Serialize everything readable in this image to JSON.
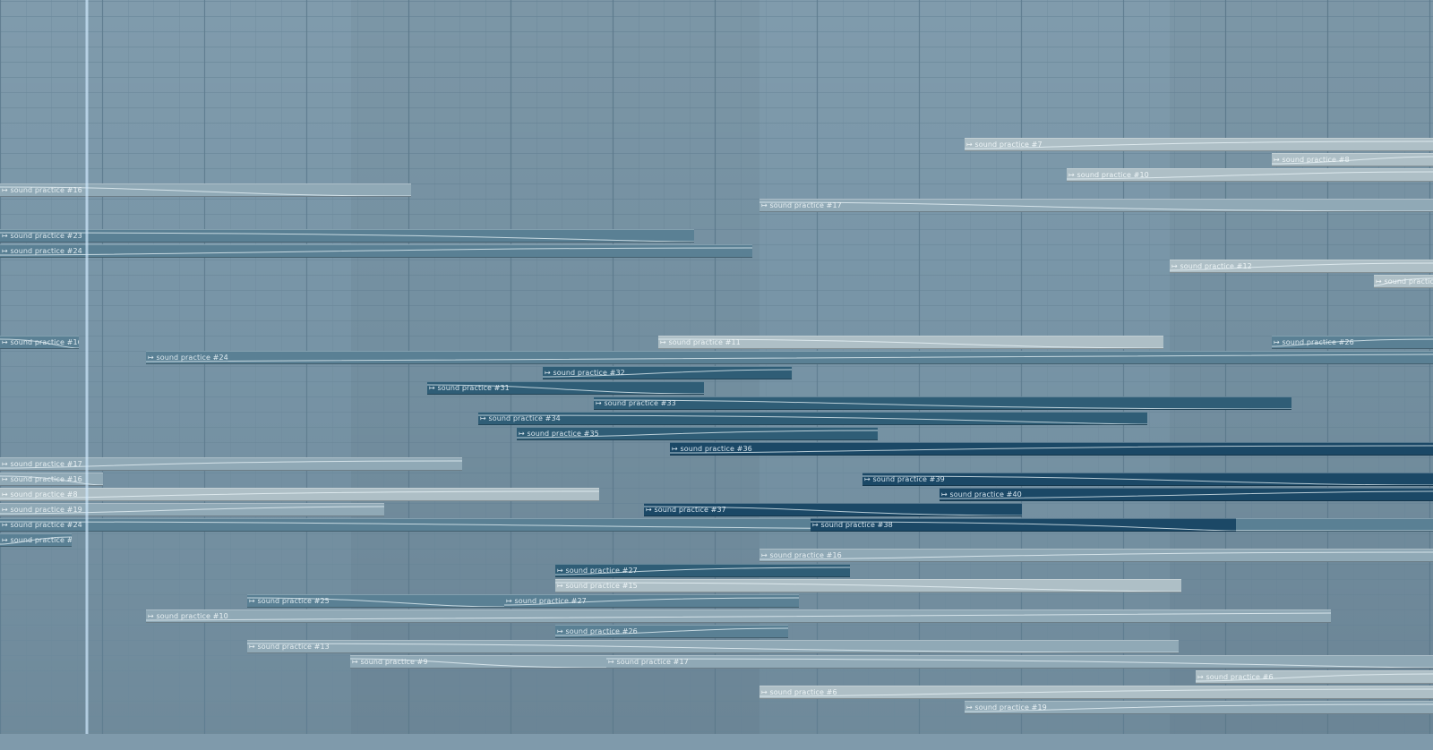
{
  "playlist": {
    "clip_prefix_icon": "audio-clip-icon",
    "clips": [
      {
        "label": "sound practice  #7",
        "row": 9,
        "start": 1077,
        "end": 1600,
        "tone": "pale"
      },
      {
        "label": "sound practice  #8",
        "row": 10,
        "start": 1420,
        "end": 1600,
        "tone": "pale"
      },
      {
        "label": "sound practice  #10",
        "row": 11,
        "start": 1191,
        "end": 1600,
        "tone": "pale"
      },
      {
        "label": "sound practice  #16",
        "row": 12,
        "start": 0,
        "end": 459,
        "tone": "light"
      },
      {
        "label": "sound practice  #17",
        "row": 13,
        "start": 848,
        "end": 1600,
        "tone": "light"
      },
      {
        "label": "sound practice  #23",
        "row": 15,
        "start": 0,
        "end": 775,
        "tone": "mid"
      },
      {
        "label": "sound practice  #24",
        "row": 16,
        "start": 0,
        "end": 840,
        "tone": "mid"
      },
      {
        "label": "sound practice  #12",
        "row": 17,
        "start": 1306,
        "end": 1600,
        "tone": "pale"
      },
      {
        "label": "sound practice  #13",
        "row": 18,
        "start": 1534,
        "end": 1600,
        "tone": "pale"
      },
      {
        "label": "sound practice  #16",
        "row": 22,
        "start": 0,
        "end": 88,
        "tone": "mid"
      },
      {
        "label": "sound practice  #11",
        "row": 22,
        "start": 735,
        "end": 1299,
        "tone": "pale"
      },
      {
        "label": "sound practice  #26",
        "row": 22,
        "start": 1420,
        "end": 1600,
        "tone": "mid"
      },
      {
        "label": "sound practice  #24",
        "row": 23,
        "start": 163,
        "end": 1600,
        "tone": "mid"
      },
      {
        "label": "sound practice  #32",
        "row": 24,
        "start": 606,
        "end": 884,
        "tone": "dark"
      },
      {
        "label": "sound practice  #31",
        "row": 25,
        "start": 477,
        "end": 786,
        "tone": "dark"
      },
      {
        "label": "sound practice  #33",
        "row": 26,
        "start": 663,
        "end": 1442,
        "tone": "dark"
      },
      {
        "label": "sound practice  #34",
        "row": 27,
        "start": 534,
        "end": 1281,
        "tone": "dark"
      },
      {
        "label": "sound practice  #35",
        "row": 28,
        "start": 577,
        "end": 980,
        "tone": "dark"
      },
      {
        "label": "sound practice  #36",
        "row": 29,
        "start": 748,
        "end": 1600,
        "tone": "deep"
      },
      {
        "label": "sound practice  #17",
        "row": 30,
        "start": 0,
        "end": 516,
        "tone": "light"
      },
      {
        "label": "sound practice  #16",
        "row": 31,
        "start": 0,
        "end": 115,
        "tone": "light"
      },
      {
        "label": "sound practice  #39",
        "row": 31,
        "start": 963,
        "end": 1600,
        "tone": "deep"
      },
      {
        "label": "sound practice  #8",
        "row": 32,
        "start": 0,
        "end": 669,
        "tone": "pale"
      },
      {
        "label": "sound practice  #40",
        "row": 32,
        "start": 1049,
        "end": 1600,
        "tone": "deep"
      },
      {
        "label": "sound practice  #19",
        "row": 33,
        "start": 0,
        "end": 429,
        "tone": "light"
      },
      {
        "label": "sound practice  #37",
        "row": 33,
        "start": 719,
        "end": 1141,
        "tone": "deep"
      },
      {
        "label": "sound practice  #24",
        "row": 34,
        "start": 0,
        "end": 1600,
        "tone": "mid"
      },
      {
        "label": "sound practice  #38",
        "row": 34,
        "start": 905,
        "end": 1380,
        "tone": "deep"
      },
      {
        "label": "sound practice  #26",
        "row": 35,
        "start": 0,
        "end": 80,
        "tone": "mid"
      },
      {
        "label": "sound practice  #16",
        "row": 36,
        "start": 848,
        "end": 1600,
        "tone": "light"
      },
      {
        "label": "sound practice  #27",
        "row": 37,
        "start": 620,
        "end": 949,
        "tone": "dark"
      },
      {
        "label": "sound practice  #15",
        "row": 38,
        "start": 620,
        "end": 1319,
        "tone": "pale"
      },
      {
        "label": "sound practice  #25",
        "row": 39,
        "start": 276,
        "end": 563,
        "tone": "mid"
      },
      {
        "label": "sound practice  #27",
        "row": 39,
        "start": 563,
        "end": 892,
        "tone": "mid"
      },
      {
        "label": "sound practice  #10",
        "row": 40,
        "start": 163,
        "end": 1486,
        "tone": "light"
      },
      {
        "label": "sound practice  #26",
        "row": 41,
        "start": 620,
        "end": 880,
        "tone": "mid"
      },
      {
        "label": "sound practice  #13",
        "row": 42,
        "start": 276,
        "end": 1316,
        "tone": "light"
      },
      {
        "label": "sound practice  #9",
        "row": 43,
        "start": 391,
        "end": 677,
        "tone": "light"
      },
      {
        "label": "sound practice  #17",
        "row": 43,
        "start": 677,
        "end": 1600,
        "tone": "light"
      },
      {
        "label": "sound practice  #6",
        "row": 44,
        "start": 1335,
        "end": 1600,
        "tone": "pale"
      },
      {
        "label": "sound practice  #6",
        "row": 45,
        "start": 848,
        "end": 1600,
        "tone": "pale"
      },
      {
        "label": "sound practice  #19",
        "row": 46,
        "start": 1077,
        "end": 1600,
        "tone": "light"
      }
    ]
  },
  "colors": {
    "background": "#7895a7",
    "grid_line": "#6d8a9c",
    "bar_line": "#5f7d90",
    "playhead": "#d2ebff"
  }
}
